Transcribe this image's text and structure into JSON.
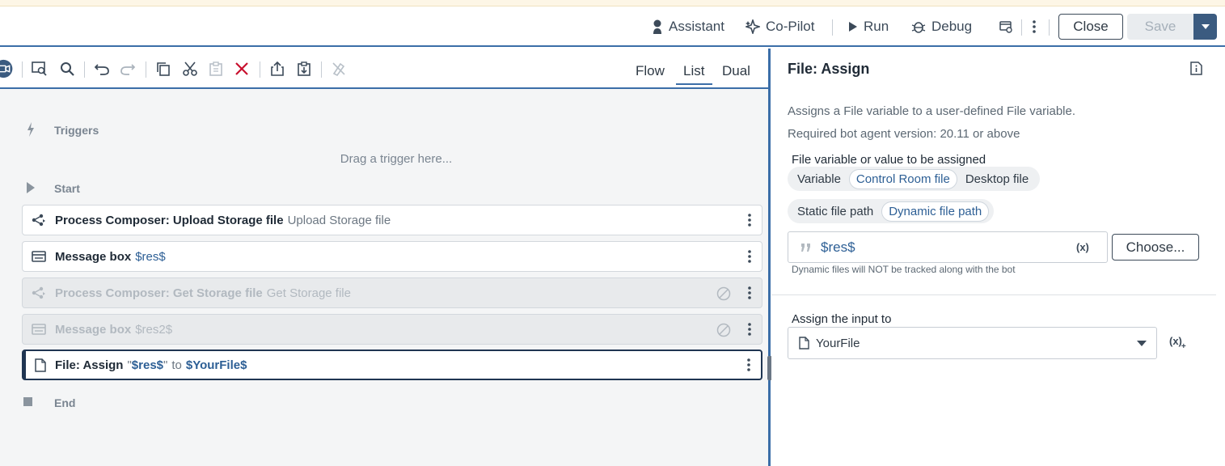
{
  "topbar": {
    "assistant_label": "Assistant",
    "copilot_label": "Co-Pilot",
    "run_label": "Run",
    "debug_label": "Debug",
    "close_label": "Close",
    "save_label": "Save"
  },
  "toolbar": {
    "views": [
      {
        "label": "Flow"
      },
      {
        "label": "List"
      },
      {
        "label": "Dual"
      }
    ],
    "active_view": "List"
  },
  "flow": {
    "triggers_label": "Triggers",
    "drag_hint": "Drag a trigger here...",
    "start_label": "Start",
    "end_label": "End",
    "steps": [
      {
        "title": "Process Composer: Upload Storage file",
        "sub": "Upload Storage file",
        "state": "enabled",
        "icon": "process-composer-icon"
      },
      {
        "title": "Message box",
        "var": "$res$",
        "state": "enabled",
        "icon": "message-box-icon"
      },
      {
        "title": "Process Composer: Get Storage file",
        "sub": "Get Storage file",
        "state": "disabled",
        "icon": "process-composer-icon"
      },
      {
        "title": "Message box",
        "var": "$res2$",
        "state": "disabled",
        "icon": "message-box-icon"
      },
      {
        "title": "File: Assign",
        "quote_open": "\"",
        "var1": "$res$",
        "quote_close": "\"",
        "to": "to",
        "var2": "$YourFile$",
        "state": "selected",
        "icon": "file-icon"
      }
    ]
  },
  "panel": {
    "title": "File: Assign",
    "description": "Assigns a File variable to a user-defined File variable.",
    "version_note": "Required bot agent version: 20.11 or above",
    "value_label": "File variable or value to be assigned",
    "source_options": [
      "Variable",
      "Control Room file",
      "Desktop file"
    ],
    "source_selected": "Control Room file",
    "path_options": [
      "Static file path",
      "Dynamic file path"
    ],
    "path_selected": "Dynamic file path",
    "input_value": "$res$",
    "var_symbol": "(x)",
    "choose_label": "Choose...",
    "dynamic_note": "Dynamic files will NOT be tracked along with the bot",
    "assign_label": "Assign the input to",
    "assign_value": "YourFile"
  },
  "colors": {
    "accent": "#3b6ea8",
    "variable_text": "#2d5f95",
    "danger": "#c8102e",
    "selected_border": "#1f3552"
  }
}
